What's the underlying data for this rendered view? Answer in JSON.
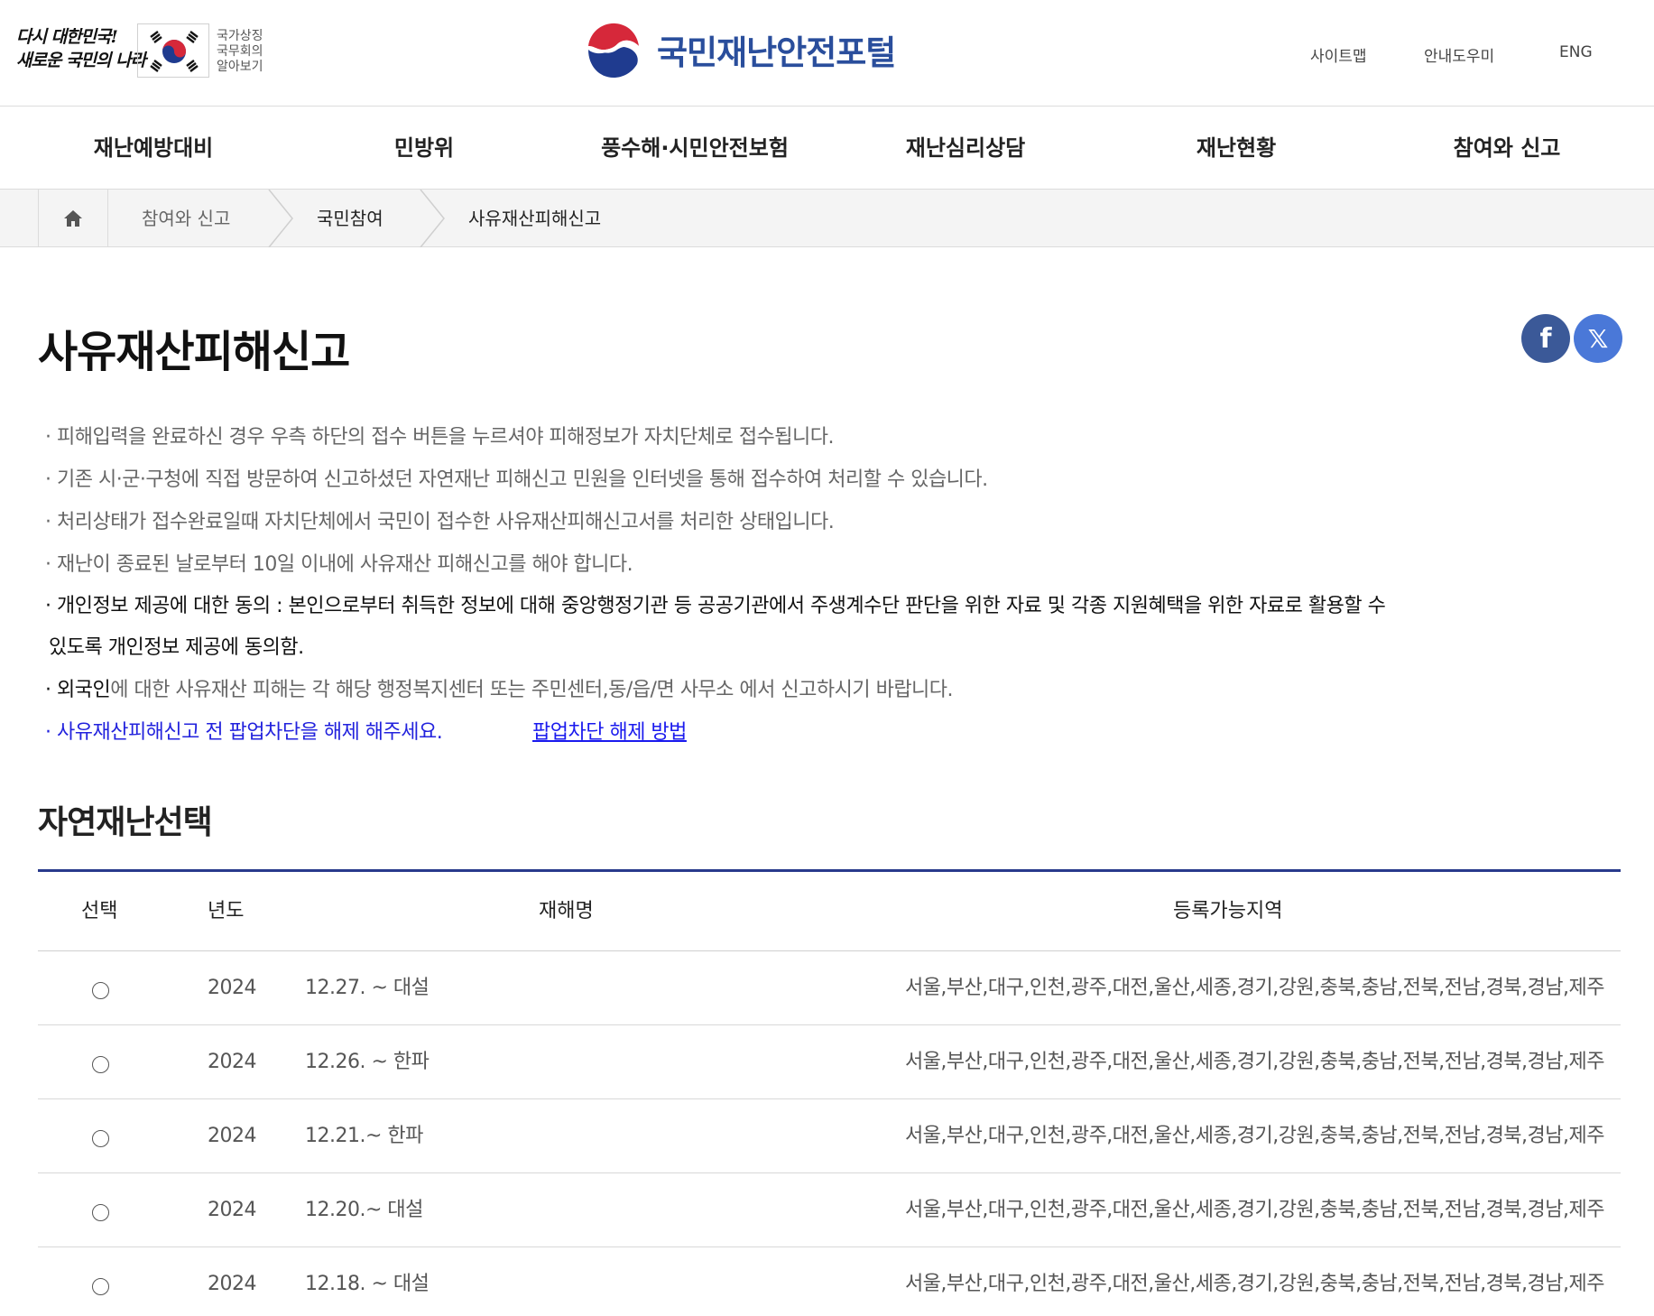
{
  "header": {
    "slogan_line1": "다시 대한민국!",
    "slogan_line2": "새로운 국민의 나라",
    "symbol_caption": [
      "국가상징",
      "국무회의",
      "알아보기"
    ],
    "brand_title": "국민재난안전포털",
    "util_links": [
      "사이트맵",
      "안내도우미",
      "ENG"
    ]
  },
  "gnb": [
    "재난예방대비",
    "민방위",
    "풍수해·시민안전보험",
    "재난심리상담",
    "재난현황",
    "참여와 신고"
  ],
  "breadcrumb": [
    "참여와 신고",
    "국민참여",
    "사유재산피해신고"
  ],
  "page_title": "사유재산피해신고",
  "share": {
    "facebook": "f",
    "x": "𝕏"
  },
  "notices": {
    "n1": "· 피해입력을 완료하신 경우 우측 하단의 접수 버튼을 누르셔야 피해정보가 자치단체로 접수됩니다.",
    "n2": "· 기존 시·군·구청에 직접 방문하여 신고하셨던 자연재난 피해신고 민원을 인터넷을 통해 접수하여 처리할 수 있습니다.",
    "n3": "· 처리상태가 접수완료일때 자치단체에서 국민이 접수한 사유재산피해신고서를 처리한 상태입니다.",
    "n4": "· 재난이 종료된 날로부터 10일 이내에 사유재산 피해신고를 해야 합니다.",
    "n5a": "· 개인정보 제공에 대한 동의 : 본인으로부터 취득한 정보에 대해 중앙행정기관 등 공공기관에서 주생계수단 판단을 위한 자료 및 각종 지원혜택을 위한 자료로 활용할 수",
    "n5b": "있도록 개인정보 제공에 동의함.",
    "n6_strong": "· 외국인",
    "n6_rest": "에 대한 사유재산 피해는 각 해당 행정복지센터 또는 주민센터,동/읍/면 사무소 에서 신고하시기 바랍니다.",
    "n7": "· 사유재산피해신고 전 팝업차단을 해제 해주세요.",
    "n7_link": "팝업차단 해제 방법"
  },
  "section_title": "자연재난선택",
  "table": {
    "headers": [
      "선택",
      "년도",
      "재해명",
      "등록가능지역"
    ],
    "rows": [
      {
        "year": "2024",
        "name": "12.27. ~ 대설",
        "regions": "서울,부산,대구,인천,광주,대전,울산,세종,경기,강원,충북,충남,전북,전남,경북,경남,제주"
      },
      {
        "year": "2024",
        "name": "12.26. ~ 한파",
        "regions": "서울,부산,대구,인천,광주,대전,울산,세종,경기,강원,충북,충남,전북,전남,경북,경남,제주"
      },
      {
        "year": "2024",
        "name": "12.21.~ 한파",
        "regions": "서울,부산,대구,인천,광주,대전,울산,세종,경기,강원,충북,충남,전북,전남,경북,경남,제주"
      },
      {
        "year": "2024",
        "name": "12.20.~ 대설",
        "regions": "서울,부산,대구,인천,광주,대전,울산,세종,경기,강원,충북,충남,전북,전남,경북,경남,제주"
      },
      {
        "year": "2024",
        "name": "12.18. ~ 대설",
        "regions": "서울,부산,대구,인천,광주,대전,울산,세종,경기,강원,충북,충남,전북,전남,경북,경남,제주"
      }
    ]
  },
  "colors": {
    "brand": "#2a4e9c",
    "table_top": "#283a8c",
    "link": "#1a1aee",
    "emblem_red": "#d6283a",
    "emblem_blue": "#1f3b8f"
  }
}
